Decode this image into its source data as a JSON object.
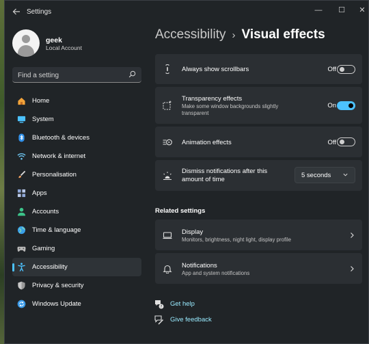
{
  "window": {
    "app_title": "Settings",
    "controls": {
      "minimize": "—",
      "maximize": "☐",
      "close": "✕"
    }
  },
  "account": {
    "name": "geek",
    "type": "Local Account"
  },
  "search": {
    "placeholder": "Find a setting"
  },
  "sidebar": {
    "items": [
      {
        "label": "Home",
        "icon": "home-icon",
        "color": "#f2a33a"
      },
      {
        "label": "System",
        "icon": "system-icon",
        "color": "#4cc2ff"
      },
      {
        "label": "Bluetooth & devices",
        "icon": "bluetooth-icon",
        "color": "#2f8fe8"
      },
      {
        "label": "Network & internet",
        "icon": "network-icon",
        "color": "#6cc4f0"
      },
      {
        "label": "Personalisation",
        "icon": "brush-icon",
        "color": "#f0a060"
      },
      {
        "label": "Apps",
        "icon": "apps-icon",
        "color": "#8fa8d8"
      },
      {
        "label": "Accounts",
        "icon": "accounts-icon",
        "color": "#3cc48a"
      },
      {
        "label": "Time & language",
        "icon": "globe-icon",
        "color": "#3aa0e8"
      },
      {
        "label": "Gaming",
        "icon": "gaming-icon",
        "color": "#b8b8b8"
      },
      {
        "label": "Accessibility",
        "icon": "accessibility-icon",
        "color": "#4cc2ff",
        "active": true
      },
      {
        "label": "Privacy & security",
        "icon": "shield-icon",
        "color": "#9a9a9a"
      },
      {
        "label": "Windows Update",
        "icon": "update-icon",
        "color": "#3a9ae8"
      }
    ]
  },
  "breadcrumb": {
    "parent": "Accessibility",
    "separator": "›",
    "current": "Visual effects"
  },
  "settings": [
    {
      "title": "Always show scrollbars",
      "state_label": "Off",
      "on": false,
      "icon": "scrollbar-icon"
    },
    {
      "title": "Transparency effects",
      "subtitle": "Make some window backgrounds slightly transparent",
      "state_label": "On",
      "on": true,
      "icon": "transparency-icon"
    },
    {
      "title": "Animation effects",
      "state_label": "Off",
      "on": false,
      "icon": "animation-icon"
    },
    {
      "title": "Dismiss notifications after this amount of time",
      "select_value": "5 seconds",
      "icon": "brightness-icon"
    }
  ],
  "related": {
    "title": "Related settings",
    "items": [
      {
        "title": "Display",
        "subtitle": "Monitors, brightness, night light, display profile",
        "icon": "monitor-icon"
      },
      {
        "title": "Notifications",
        "subtitle": "App and system notifications",
        "icon": "bell-icon"
      }
    ]
  },
  "links": [
    {
      "label": "Get help",
      "icon": "help-icon"
    },
    {
      "label": "Give feedback",
      "icon": "feedback-icon"
    }
  ],
  "colors": {
    "accent": "#4cc2ff",
    "link": "#99ebff",
    "card": "#2b2f33",
    "window": "#202427"
  }
}
